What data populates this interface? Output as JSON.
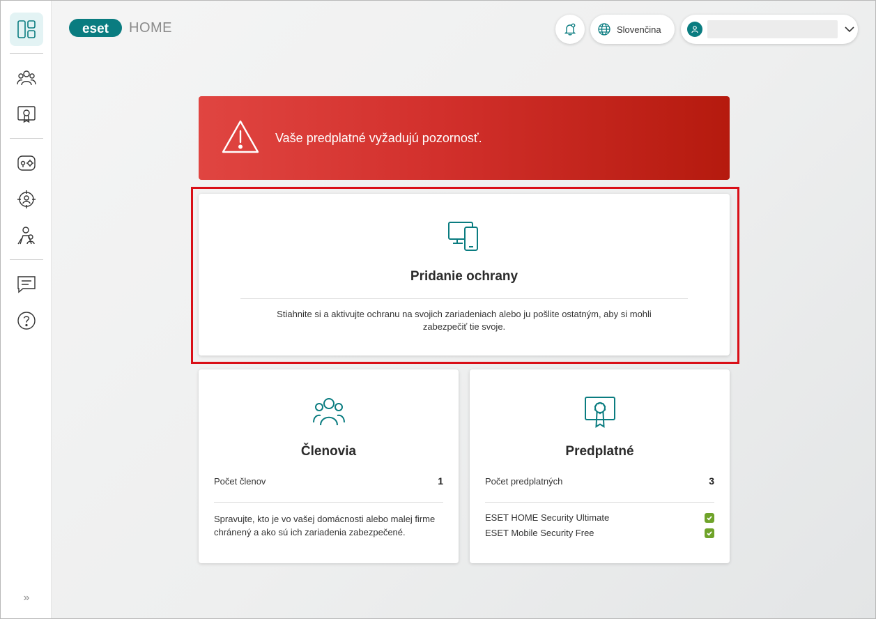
{
  "app": {
    "logo_text": "eset",
    "logo_suffix": "HOME"
  },
  "header": {
    "language": "Slovenčina"
  },
  "sidebar": {
    "items": [
      {
        "icon": "dashboard-icon"
      },
      {
        "icon": "members-icon"
      },
      {
        "icon": "subscriptions-icon"
      },
      {
        "icon": "device-settings-icon"
      },
      {
        "icon": "anti-theft-icon"
      },
      {
        "icon": "parental-control-icon"
      },
      {
        "icon": "feedback-icon"
      },
      {
        "icon": "help-icon"
      }
    ],
    "expand": "»"
  },
  "alert": {
    "text": "Vaše predplatné vyžadujú pozornosť."
  },
  "add_protection": {
    "title": "Pridanie ochrany",
    "description": "Stiahnite si a aktivujte ochranu na svojich zariadeniach alebo ju pošlite ostatným, aby si mohli zabezpečiť tie svoje."
  },
  "members": {
    "title": "Členovia",
    "count_label": "Počet členov",
    "count": "1",
    "description": "Spravujte, kto je vo vašej domácnosti alebo malej firme chránený a ako sú ich zariadenia zabezpečené."
  },
  "subscriptions": {
    "title": "Predplatné",
    "count_label": "Počet predplatných",
    "count": "3",
    "items": [
      {
        "name": "ESET HOME Security Ultimate",
        "status": "ok"
      },
      {
        "name": "ESET Mobile Security Free",
        "status": "ok"
      }
    ]
  },
  "colors": {
    "accent": "#0a7c80",
    "alert": "#d2302c",
    "highlight": "#d90f17",
    "ok": "#6fa32a"
  }
}
